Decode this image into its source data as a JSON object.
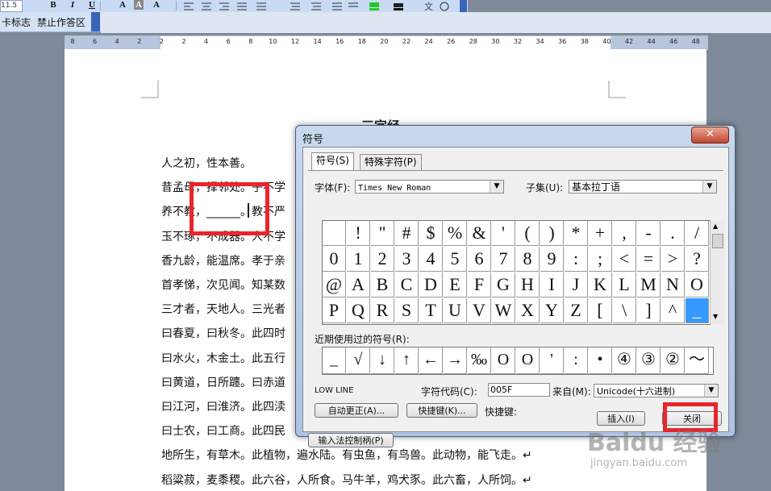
{
  "toolbar": {
    "font_size": "11.5",
    "buttons": [
      "B",
      "I",
      "U",
      "A",
      "A",
      "A"
    ]
  },
  "toolbar2": {
    "item1": "卡标志",
    "item2": "禁止作答区"
  },
  "ruler": {
    "labels": [
      "8",
      "6",
      "4",
      "2",
      "2",
      "2",
      "4",
      "6",
      "8",
      "10",
      "12",
      "14",
      "16",
      "18",
      "20",
      "22",
      "24",
      "26",
      "28",
      "30",
      "32",
      "34",
      "36",
      "38",
      "40",
      "42",
      "44",
      "46",
      "48"
    ]
  },
  "document": {
    "heading": "三字经",
    "lines": [
      "人之初，性本善。",
      "昔孟母，择邻处。子不学",
      "养不教，______。教不严",
      "玉不琢，不成器。人不学",
      "香九龄，能温席。孝于亲",
      "首孝悌，次见闻。知某数",
      "三才者，天地人。三光者",
      "曰春夏，曰秋冬。此四时",
      "曰水火，木金土。此五行",
      "曰黄道，日所躔。曰赤道",
      "曰江河，曰淮济。此四渎",
      "曰士农，曰工商。此四民",
      "地所生，有草木。此植物，遍水陆。有虫鱼，有鸟兽。此动物，能飞走。↵",
      "稻粱菽，麦黍稷。此六谷，人所食。马牛羊，鸡犬豕。此六畜，人所饲。↵"
    ]
  },
  "dialog": {
    "title": "符号",
    "close_x": "✕",
    "tabs": [
      "符号(S)",
      "特殊字符(P)"
    ],
    "font_label": "字体(F):",
    "font_value": "Times New Roman",
    "subset_label": "子集(U):",
    "subset_value": "基本拉丁语",
    "symbols": [
      [
        "",
        "!",
        "\"",
        "#",
        "$",
        "%",
        "&",
        "'",
        "(",
        ")",
        "*",
        "+",
        ",",
        "-",
        ".",
        "/"
      ],
      [
        "0",
        "1",
        "2",
        "3",
        "4",
        "5",
        "6",
        "7",
        "8",
        "9",
        ":",
        ";",
        "<",
        "=",
        ">",
        "?"
      ],
      [
        "@",
        "A",
        "B",
        "C",
        "D",
        "E",
        "F",
        "G",
        "H",
        "I",
        "J",
        "K",
        "L",
        "M",
        "N",
        "O"
      ],
      [
        "P",
        "Q",
        "R",
        "S",
        "T",
        "U",
        "V",
        "W",
        "X",
        "Y",
        "Z",
        "[",
        "\\",
        "]",
        "^",
        "_"
      ]
    ],
    "recent_label": "近期使用过的符号(R):",
    "recent": [
      "_",
      "√",
      "↓",
      "↑",
      "←",
      "→",
      "‰",
      "O",
      "O",
      "'",
      ":",
      "•",
      "④",
      "③",
      "②",
      "～"
    ],
    "char_name": "LOW LINE",
    "charcode_label": "字符代码(C):",
    "charcode_value": "005F",
    "from_label": "来自(M):",
    "from_value": "Unicode(十六进制)",
    "autocorrect_button": "自动更正(A)...",
    "shortcut_button": "快捷键(K)...",
    "shortcut_label": "快捷键:",
    "ime_button": "输入法控制柄(P)",
    "insert_button": "插入(I)",
    "close_button": "关闭"
  },
  "watermark": {
    "main": "Baidu 经验",
    "sub": "jingyan.baidu.com"
  }
}
